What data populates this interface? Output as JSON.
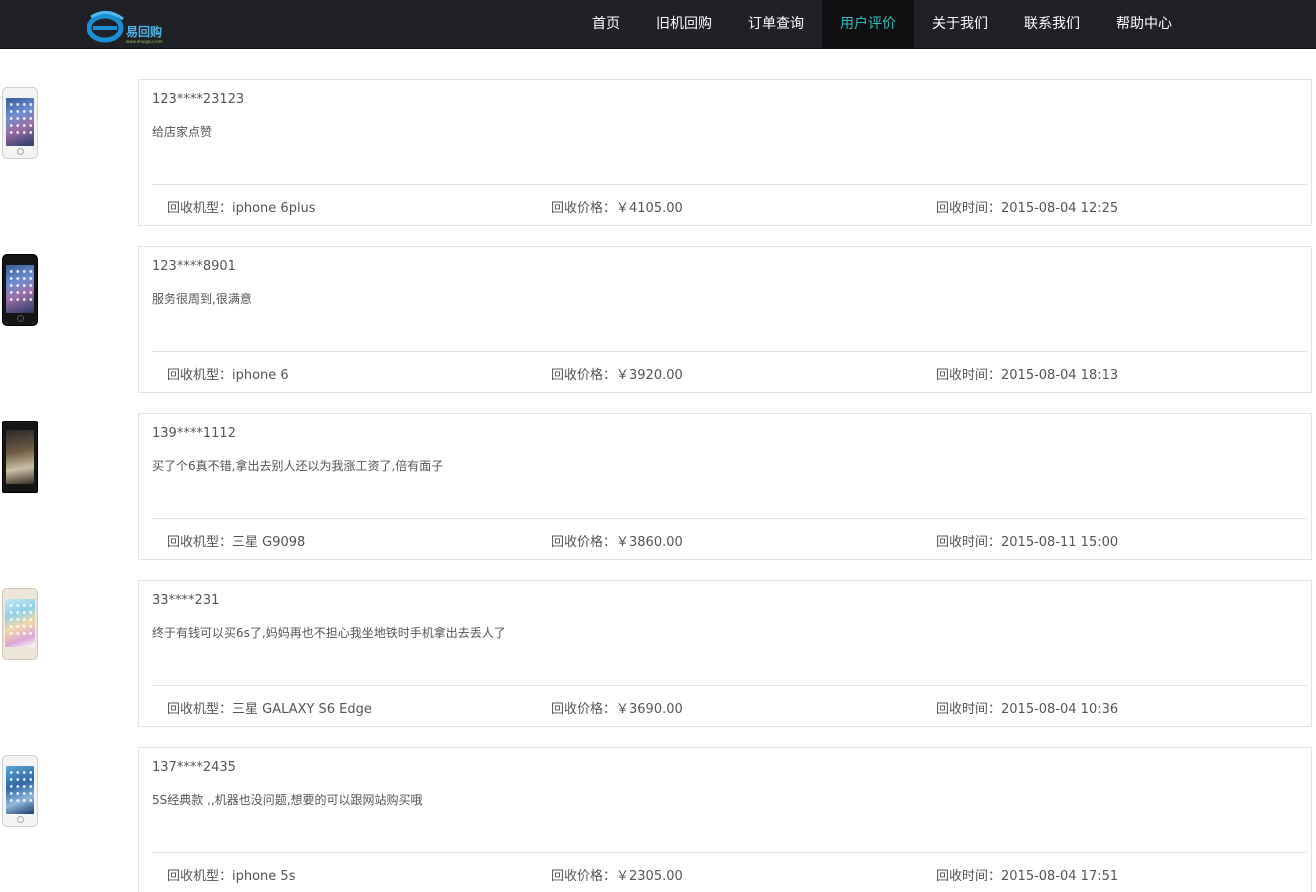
{
  "header": {
    "logo_text": "易回购",
    "logo_url": "www.ehuigou.com",
    "nav": [
      {
        "label": "首页"
      },
      {
        "label": "旧机回购"
      },
      {
        "label": "订单查询"
      },
      {
        "label": "用户评价",
        "active": true
      },
      {
        "label": "关于我们"
      },
      {
        "label": "联系我们"
      },
      {
        "label": "帮助中心"
      }
    ]
  },
  "colors": {
    "header_bg": "#1f2126",
    "nav_active_bg": "#0e0f11",
    "nav_active_text": "#2ec1b9",
    "nav_text": "#ffffff",
    "card_border": "#e4e4e4"
  },
  "reviews": [
    {
      "user": "123****23123",
      "comment": "给店家点赞",
      "model": "回收机型：iphone 6plus",
      "price": "回收价格：￥4105.00",
      "time": "回收时间：2015-08-04 12:25",
      "phone_icon": "iphone-white-icon"
    },
    {
      "user": "123****8901",
      "comment": "服务很周到,很满意",
      "model": "回收机型：iphone 6",
      "price": "回收价格：￥3920.00",
      "time": "回收时间：2015-08-04 18:13",
      "phone_icon": "iphone-black-icon"
    },
    {
      "user": "139****1112",
      "comment": "买了个6真不错,拿出去别人还以为我涨工资了,倍有面子",
      "model": "回收机型：三星 G9098",
      "price": "回收价格：￥3860.00",
      "time": "回收时间：2015-08-11 15:00",
      "phone_icon": "samsung-flip-icon"
    },
    {
      "user": "33****231",
      "comment": "终于有钱可以买6s了,妈妈再也不担心我坐地铁时手机拿出去丢人了",
      "model": "回收机型：三星 GALAXY S6 Edge",
      "price": "回收价格：￥3690.00",
      "time": "回收时间：2015-08-04 10:36",
      "phone_icon": "galaxy-s6-edge-icon"
    },
    {
      "user": "137****2435",
      "comment": "5S经典款 ,,机器也没问题,想要的可以跟网站购买哦",
      "model": "回收机型：iphone 5s",
      "price": "回收价格：￥2305.00",
      "time": "回收时间：2015-08-04 17:51",
      "phone_icon": "iphone-5s-icon"
    }
  ]
}
